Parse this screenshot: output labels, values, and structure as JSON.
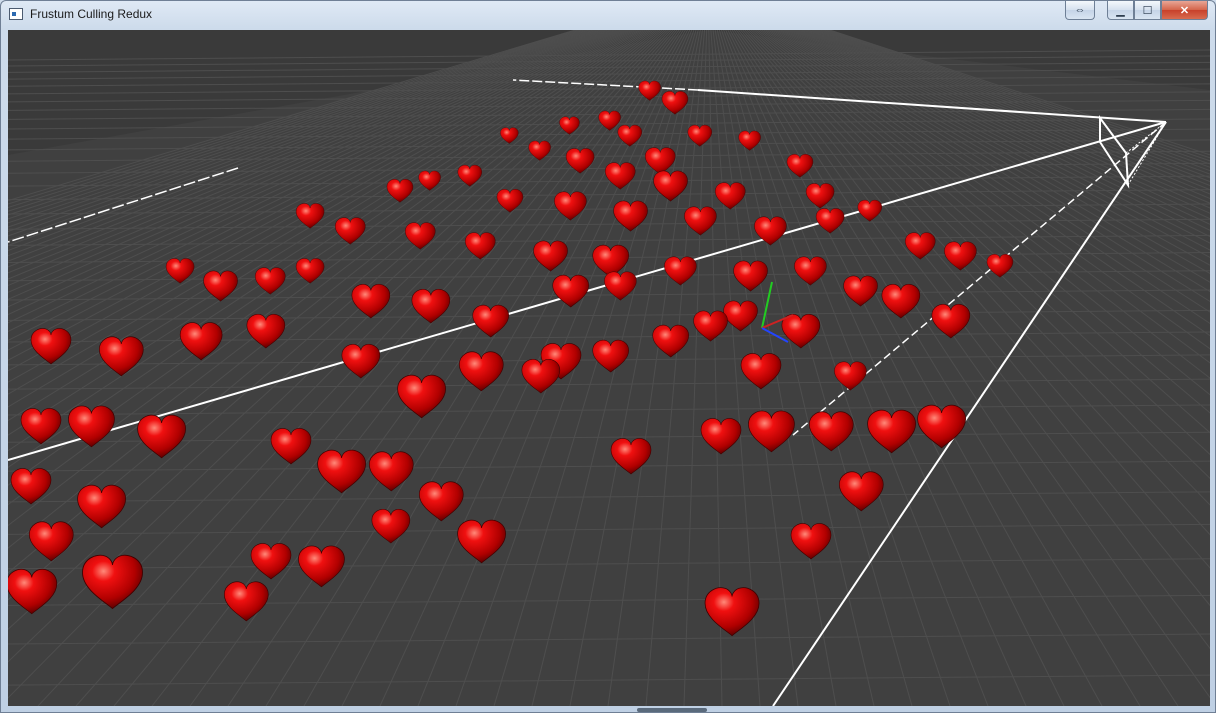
{
  "window": {
    "title": "Frustum Culling Redux",
    "buttons": {
      "extra": "⇔",
      "minimize": "▁",
      "maximize": "☐",
      "close": "✕"
    }
  },
  "scene": {
    "background_color": "#3a3a3a",
    "grid_color": "#555555",
    "heart_color": "#d40000",
    "frustum_color": "#ffffff",
    "axis_colors": {
      "x": "#cc2222",
      "y": "#22cc22",
      "z": "#2244ff"
    }
  }
}
